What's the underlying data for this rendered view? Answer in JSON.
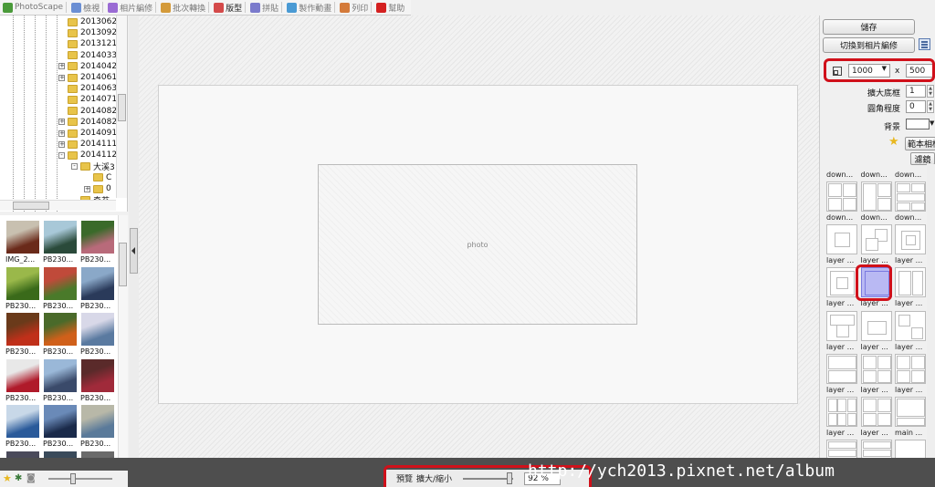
{
  "menu": [
    {
      "label": "PhotoScape",
      "icon": "photoscape-icon",
      "color": "#4a9a3a"
    },
    {
      "label": "檢視",
      "icon": "viewer-icon",
      "color": "#6b8fd4"
    },
    {
      "label": "相片編修",
      "icon": "editor-icon",
      "color": "#9a6bd4"
    },
    {
      "label": "批次轉換",
      "icon": "batch-icon",
      "color": "#d49a3a"
    },
    {
      "label": "版型",
      "icon": "page-icon",
      "color": "#d44a4a",
      "active": true
    },
    {
      "label": "拼貼",
      "icon": "combine-icon",
      "color": "#7a7acc"
    },
    {
      "label": "製作動畫",
      "icon": "animated-gif-icon",
      "color": "#4a9ad4"
    },
    {
      "label": "列印",
      "icon": "print-icon",
      "color": "#d47a3a"
    },
    {
      "label": "幫助",
      "icon": "help-icon",
      "color": "#d42020"
    }
  ],
  "folder_tree": [
    {
      "label": "2013062",
      "expander": ""
    },
    {
      "label": "2013092",
      "expander": ""
    },
    {
      "label": "2013121",
      "expander": ""
    },
    {
      "label": "2014033",
      "expander": ""
    },
    {
      "label": "2014042",
      "expander": "+"
    },
    {
      "label": "2014061",
      "expander": "+"
    },
    {
      "label": "2014063",
      "expander": ""
    },
    {
      "label": "2014071",
      "expander": ""
    },
    {
      "label": "2014082",
      "expander": ""
    },
    {
      "label": "2014082",
      "expander": "+"
    },
    {
      "label": "2014091",
      "expander": "+"
    },
    {
      "label": "2014111",
      "expander": "+"
    },
    {
      "label": "2014112",
      "expander": "-"
    },
    {
      "label": "大溪3",
      "expander": "-",
      "indent": 1
    },
    {
      "label": "C",
      "expander": "",
      "indent": 2
    },
    {
      "label": "0",
      "expander": "+",
      "indent": 2
    },
    {
      "label": "奇苔",
      "expander": "",
      "indent": 1
    }
  ],
  "thumbnails": [
    {
      "label": "IMG_2...",
      "c1": "#6a2a1a",
      "c2": "#c8c0b0"
    },
    {
      "label": "PB230...",
      "c1": "#2a4a3a",
      "c2": "#a8c8d8"
    },
    {
      "label": "PB230...",
      "c1": "#b86a7a",
      "c2": "#3a6a2a"
    },
    {
      "label": "PB230...",
      "c1": "#3a6a1a",
      "c2": "#9ab84a"
    },
    {
      "label": "PB230...",
      "c1": "#4a7a2a",
      "c2": "#c04a3a"
    },
    {
      "label": "PB230...",
      "c1": "#2a3a5a",
      "c2": "#8aa8c8"
    },
    {
      "label": "PB230...",
      "c1": "#c0301a",
      "c2": "#6a3a1a"
    },
    {
      "label": "PB230...",
      "c1": "#d0601a",
      "c2": "#4a6a2a"
    },
    {
      "label": "PB230...",
      "c1": "#5a7aa0",
      "c2": "#d8d8e8"
    },
    {
      "label": "PB230...",
      "c1": "#b01a2a",
      "c2": "#e8e8e8"
    },
    {
      "label": "PB230...",
      "c1": "#3a4a6a",
      "c2": "#9ab8d8"
    },
    {
      "label": "PB230...",
      "c1": "#a02a3a",
      "c2": "#5a2a2a"
    },
    {
      "label": "PB230...",
      "c1": "#2a5a9a",
      "c2": "#c8d8e8"
    },
    {
      "label": "PB230...",
      "c1": "#1a2a4a",
      "c2": "#6a8ab8"
    },
    {
      "label": "PB230...",
      "c1": "#5a7a9a",
      "c2": "#b8b8a8"
    },
    {
      "label": "",
      "c1": "#2a2a3a",
      "c2": "#4a4a5a"
    },
    {
      "label": "",
      "c1": "#1a2a3a",
      "c2": "#3a4a5a"
    },
    {
      "label": "",
      "c1": "#3a3a3a",
      "c2": "#6a6a6a"
    }
  ],
  "canvas": {
    "placeholder": "photo"
  },
  "right_panel": {
    "save_label": "儲存",
    "switch_label": "切換到相片編修",
    "width_value": "1000",
    "times": "x",
    "height_value": "500",
    "margin_label": "擴大底框",
    "margin_value": "1",
    "corner_label": "圓角程度",
    "corner_value": "0",
    "background_label": "背景",
    "sample_label": "範本相框",
    "filter_label": "濾鏡",
    "templates": [
      {
        "label": "down...",
        "kind": "blank"
      },
      {
        "label": "down...",
        "kind": "blank"
      },
      {
        "label": "down...",
        "kind": "blank"
      },
      {
        "label": "down...",
        "kind": "grid4"
      },
      {
        "label": "down...",
        "kind": "grid3"
      },
      {
        "label": "down...",
        "kind": "grid5"
      },
      {
        "label": "layer ...",
        "kind": "layer1"
      },
      {
        "label": "layer ...",
        "kind": "layer2"
      },
      {
        "label": "layer ...",
        "kind": "layer3"
      },
      {
        "label": "layer ...",
        "kind": "layer4"
      },
      {
        "label": "layer ...",
        "kind": "selected"
      },
      {
        "label": "layer ...",
        "kind": "layer5"
      },
      {
        "label": "layer ...",
        "kind": "layer6"
      },
      {
        "label": "layer ...",
        "kind": "layer7"
      },
      {
        "label": "layer ...",
        "kind": "layer8"
      },
      {
        "label": "layer ...",
        "kind": "grid2"
      },
      {
        "label": "layer ...",
        "kind": "grid4"
      },
      {
        "label": "layer ...",
        "kind": "grid4"
      },
      {
        "label": "layer ...",
        "kind": "grid6"
      },
      {
        "label": "layer ...",
        "kind": "grid4"
      },
      {
        "label": "main ...",
        "kind": "main"
      },
      {
        "label": "layer ...",
        "kind": "strip"
      },
      {
        "label": "",
        "kind": "strip"
      },
      {
        "label": "",
        "kind": "blank"
      }
    ]
  },
  "bottom_bar": {
    "preview_label": "預覽",
    "zoom_label": "擴大/縮小",
    "zoom_value": "92 %",
    "watermark": "http://ych2013.pixnet.net/album"
  },
  "colors": {
    "highlight": "#d0101a",
    "status_bar": "#4e4e4e",
    "selected_template": "#b9b9f3"
  }
}
